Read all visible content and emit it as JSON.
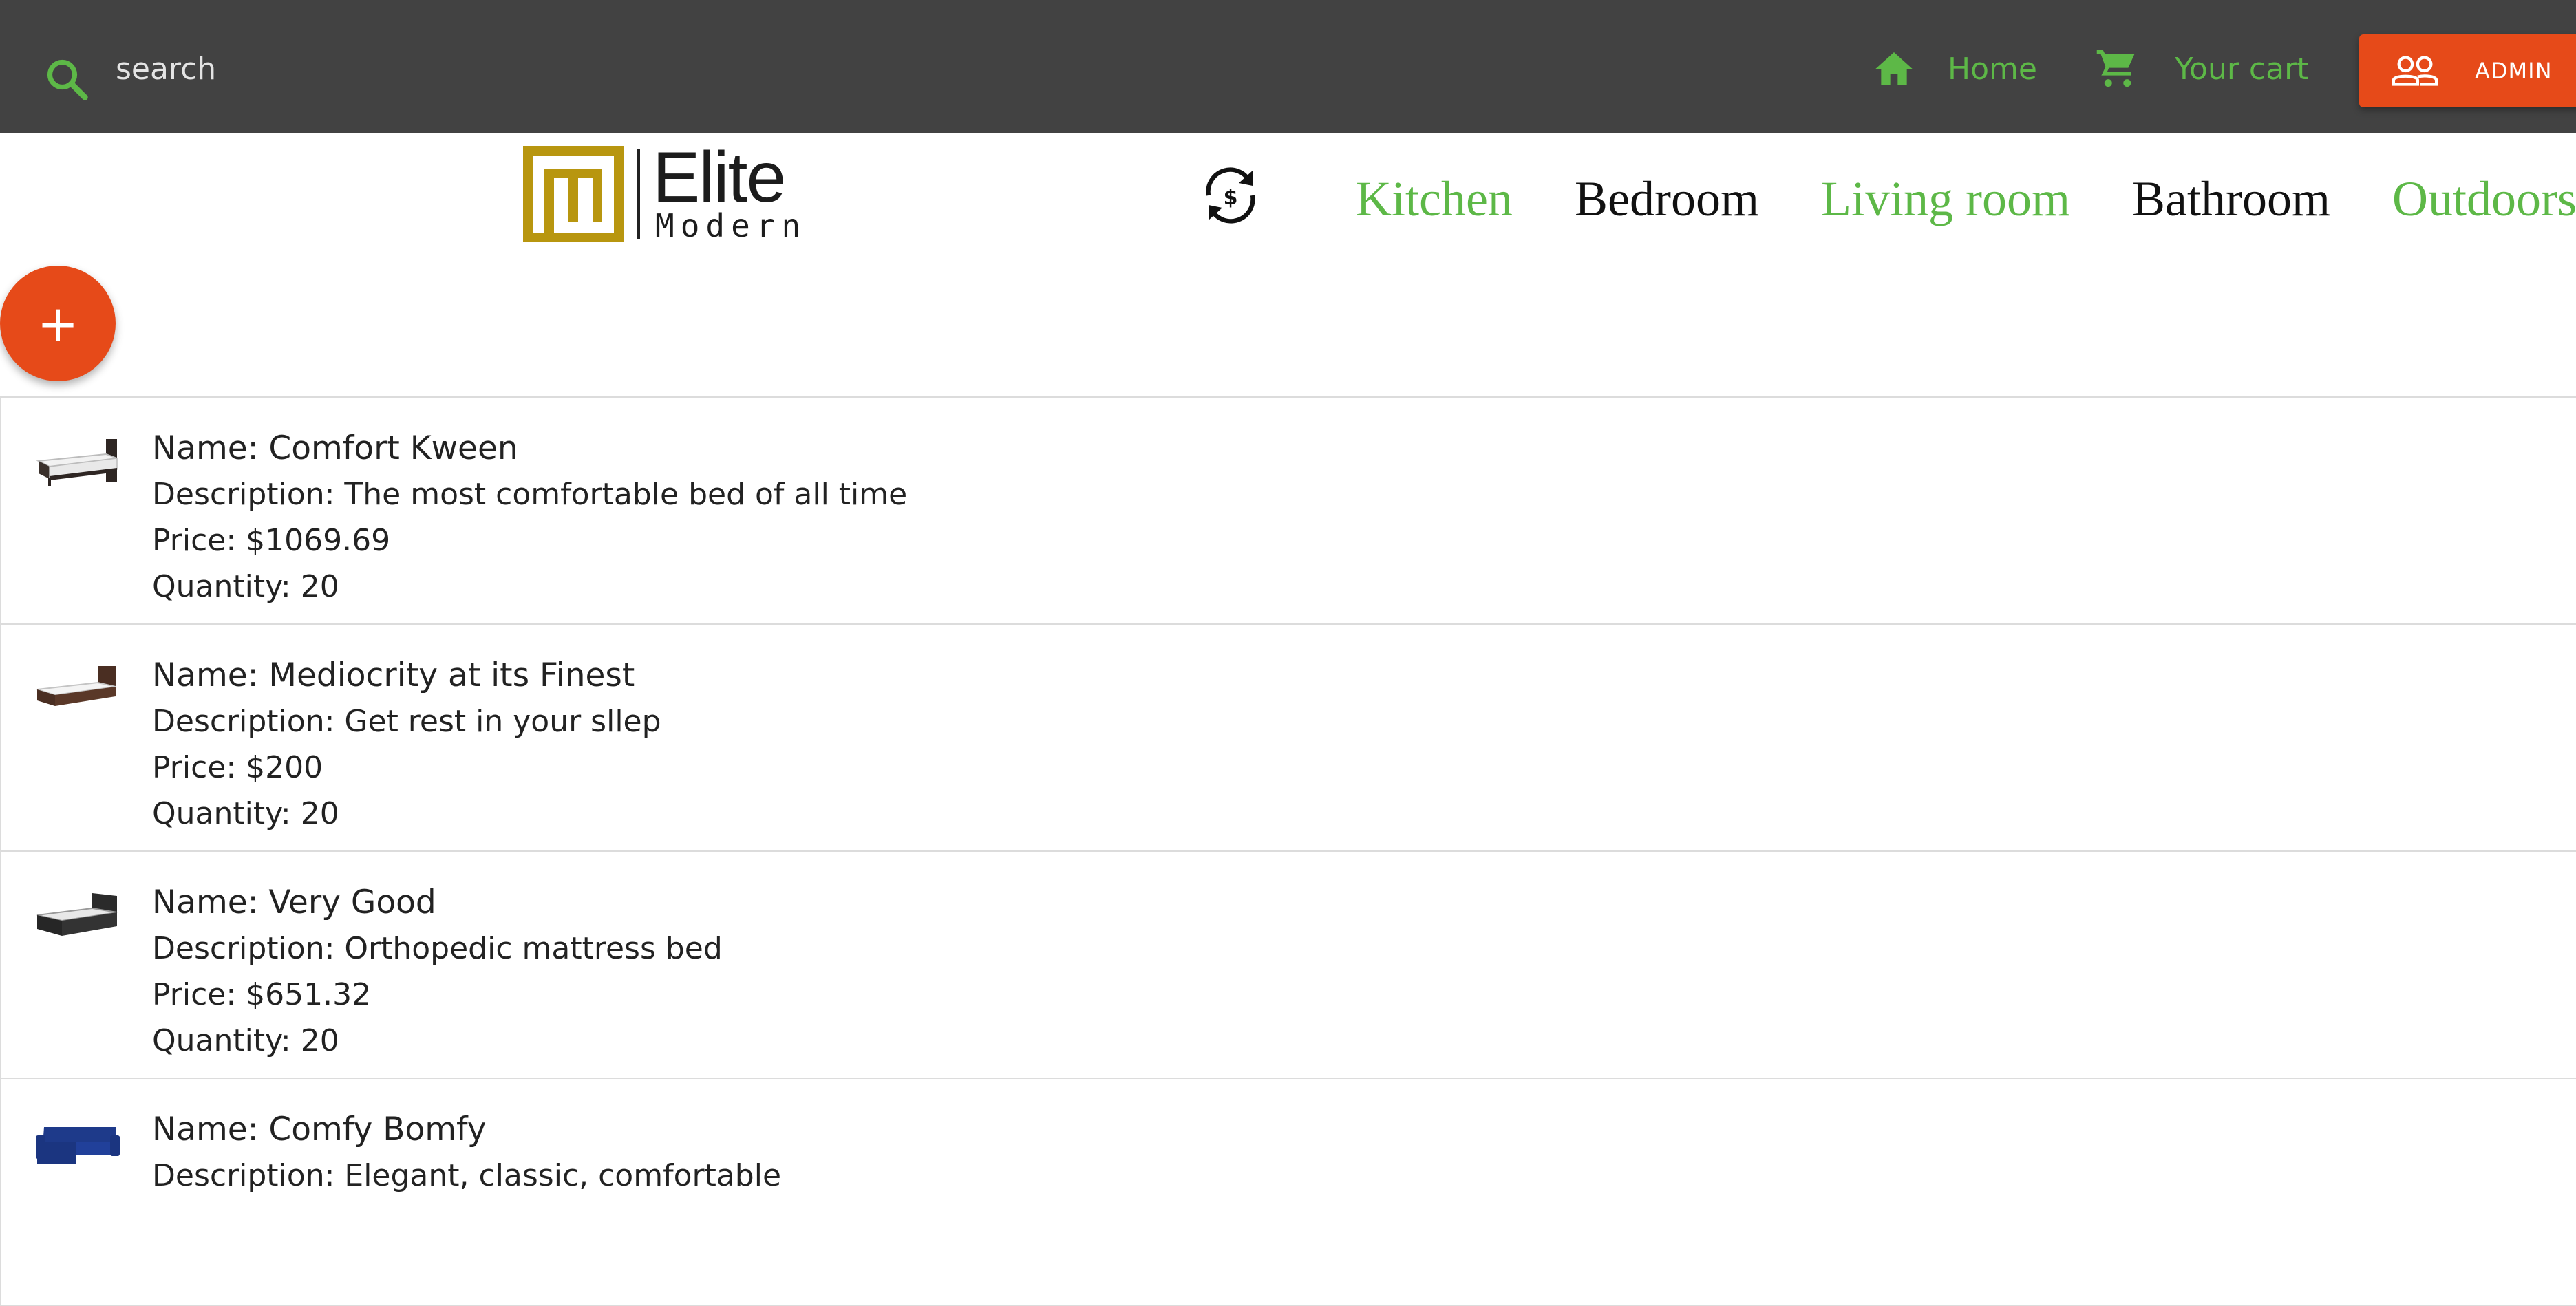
{
  "search": {
    "placeholder": "search"
  },
  "nav": {
    "home_label": "Home",
    "cart_label": "Your cart",
    "admin_label": "ADMIN"
  },
  "logo": {
    "line1": "Elite",
    "line2": "Modern"
  },
  "categories": [
    {
      "label": "Kitchen"
    },
    {
      "label": "Bedroom"
    },
    {
      "label": "Living room"
    },
    {
      "label": "Bathroom"
    },
    {
      "label": "Outdoors"
    }
  ],
  "fab": {
    "label": "+"
  },
  "products": [
    {
      "name": "Name: Comfort Kween",
      "description": "Description: The most comfortable bed of all time",
      "price": "Price: $1069.69",
      "quantity": "Quantity: 20",
      "thumb_icon": "bed-thumbnail-icon"
    },
    {
      "name": "Name: Mediocrity at its Finest",
      "description": "Description: Get rest in your sllep",
      "price": "Price: $200",
      "quantity": "Quantity: 20",
      "thumb_icon": "bed-thumbnail-icon"
    },
    {
      "name": "Name: Very Good",
      "description": "Description: Orthopedic mattress bed",
      "price": "Price: $651.32",
      "quantity": "Quantity: 20",
      "thumb_icon": "bed-thumbnail-icon"
    },
    {
      "name": "Name: Comfy Bomfy",
      "description": "Description: Elegant, classic, comfortable",
      "price": "",
      "quantity": "",
      "thumb_icon": "sofa-thumbnail-icon"
    }
  ],
  "colors": {
    "topbar": "#424242",
    "accent_green": "#5db847",
    "accent_orange": "#e64a19",
    "logo_gold": "#b8960f"
  }
}
